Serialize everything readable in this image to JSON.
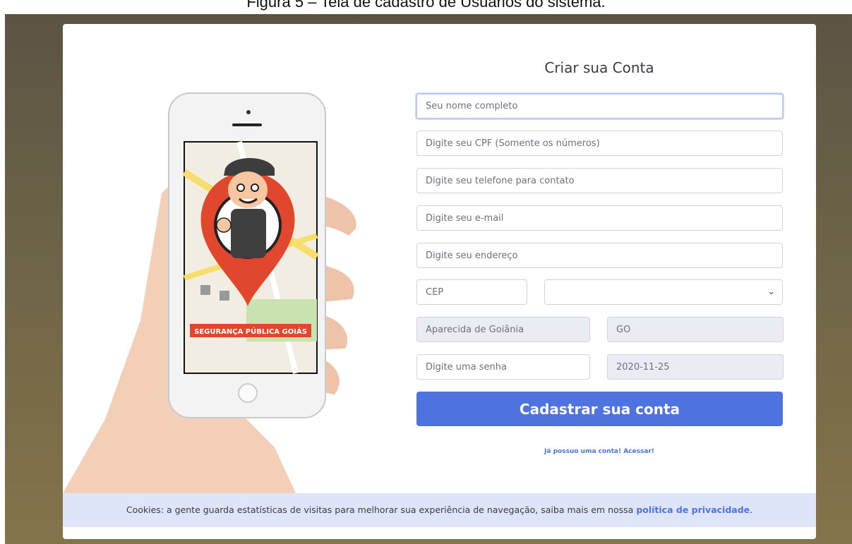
{
  "caption": "Figura 5 – Tela de cadastro de Usuários do sistema.",
  "form": {
    "title": "Criar sua Conta",
    "name_placeholder": "Seu nome completo",
    "cpf_placeholder": "Digite seu CPF (Somente os números)",
    "phone_placeholder": "Digite seu telefone para contato",
    "email_placeholder": "Digite seu e-mail",
    "address_placeholder": "Digite seu endereço",
    "cep_placeholder": "CEP",
    "neighborhood_value": "",
    "city_value": "Aparecida de Goiânia",
    "state_value": "GO",
    "password_placeholder": "Digite uma senha",
    "date_value": "2020-11-25",
    "submit_label": "Cadastrar sua conta",
    "login_link": "Já possuo uma conta! Acessar!"
  },
  "illustration": {
    "banner_text": "SEGURANÇA PÚBLICA GOIÁS"
  },
  "cookie_bar": {
    "text": "Cookies: a gente guarda estatísticas de visitas para melhorar sua experiência de navegação, saiba mais em nossa ",
    "link": "política de privacidade",
    "suffix": "."
  },
  "colors": {
    "primary": "#4e73df",
    "cookie_bg": "#dfe5f8",
    "readonly_bg": "#eaecf4"
  }
}
